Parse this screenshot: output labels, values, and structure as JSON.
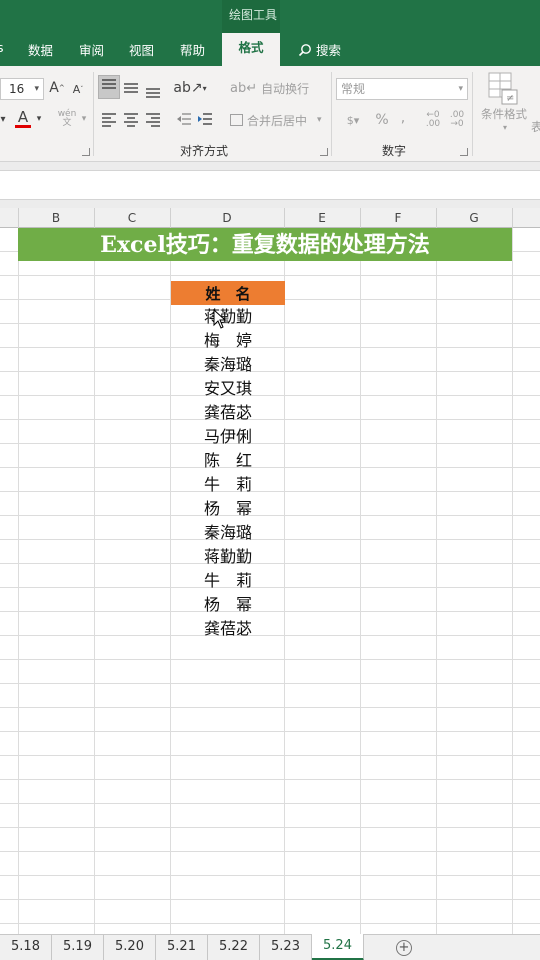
{
  "ribbon": {
    "context_title": "绘图工具",
    "tabs": [
      "数据",
      "审阅",
      "视图",
      "帮助"
    ],
    "active_tab": "格式",
    "search_label": "搜索",
    "font_size": "16",
    "wrap_text": "自动换行",
    "merge_center": "合并后居中",
    "number_format": "常规",
    "percent": "%",
    "comma": ",",
    "conditional_format": "条件格式",
    "alignment_group": "对齐方式",
    "number_group": "数字",
    "cut_off_label": "表"
  },
  "columns": [
    "B",
    "C",
    "D",
    "E",
    "F",
    "G"
  ],
  "sheet": {
    "title": "Excel技巧：重复数据的处理方法",
    "header": "姓　名",
    "names": [
      "蒋勤勤",
      "梅　婷",
      "秦海璐",
      "安又琪",
      "龚蓓苾",
      "马伊俐",
      "陈　红",
      "牛　莉",
      "杨　幂",
      "秦海璐",
      "蒋勤勤",
      "牛　莉",
      "杨　幂",
      "龚蓓苾"
    ]
  },
  "sheet_tabs": [
    "5.18",
    "5.19",
    "5.20",
    "5.21",
    "5.22",
    "5.23",
    "5.24"
  ],
  "active_sheet": "5.24",
  "colors": {
    "excel_green": "#217346",
    "title_fill": "#70ad47",
    "header_fill": "#ed7d31"
  }
}
